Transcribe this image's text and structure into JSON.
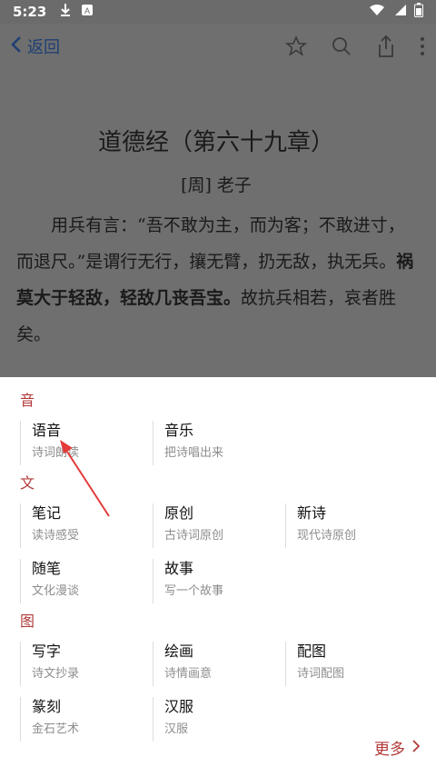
{
  "status_bar": {
    "time": "5:23",
    "icons_left": [
      "download-icon",
      "notification-icon"
    ],
    "icons_right": [
      "wifi-icon",
      "signal-icon",
      "battery-icon"
    ]
  },
  "app_bar": {
    "back_label": "返回",
    "actions": [
      "star-icon",
      "search-icon",
      "share-icon",
      "more-vertical-icon"
    ]
  },
  "poem": {
    "title": "道德经（第六十九章）",
    "author": "[周] 老子",
    "body_part1": "用兵有言：“吾不敢为主，而为客；不敢进寸，而退尺。”是谓行无行，攘无臂，扔无敌，执无兵。",
    "body_bold": "祸莫大于轻敌，轻敌几丧吾宝。",
    "body_part2": "故抗兵相若，哀者胜矣。"
  },
  "sheet": {
    "sections": [
      {
        "header": "音",
        "items": [
          {
            "title": "语音",
            "sub": "诗词朗读"
          },
          {
            "title": "音乐",
            "sub": "把诗唱出来"
          }
        ]
      },
      {
        "header": "文",
        "items": [
          {
            "title": "笔记",
            "sub": "读诗感受"
          },
          {
            "title": "原创",
            "sub": "古诗词原创"
          },
          {
            "title": "新诗",
            "sub": "现代诗原创"
          },
          {
            "title": "随笔",
            "sub": "文化漫谈"
          },
          {
            "title": "故事",
            "sub": "写一个故事"
          }
        ]
      },
      {
        "header": "图",
        "items": [
          {
            "title": "写字",
            "sub": "诗文抄录"
          },
          {
            "title": "绘画",
            "sub": "诗情画意"
          },
          {
            "title": "配图",
            "sub": "诗词配图"
          },
          {
            "title": "篆刻",
            "sub": "金石艺术"
          },
          {
            "title": "汉服",
            "sub": "汉服"
          }
        ]
      }
    ],
    "more_label": "更多"
  },
  "colors": {
    "accent_red": "#b13a3a",
    "back_blue": "#1f3f73",
    "annotation_arrow": "#e23b3b"
  }
}
